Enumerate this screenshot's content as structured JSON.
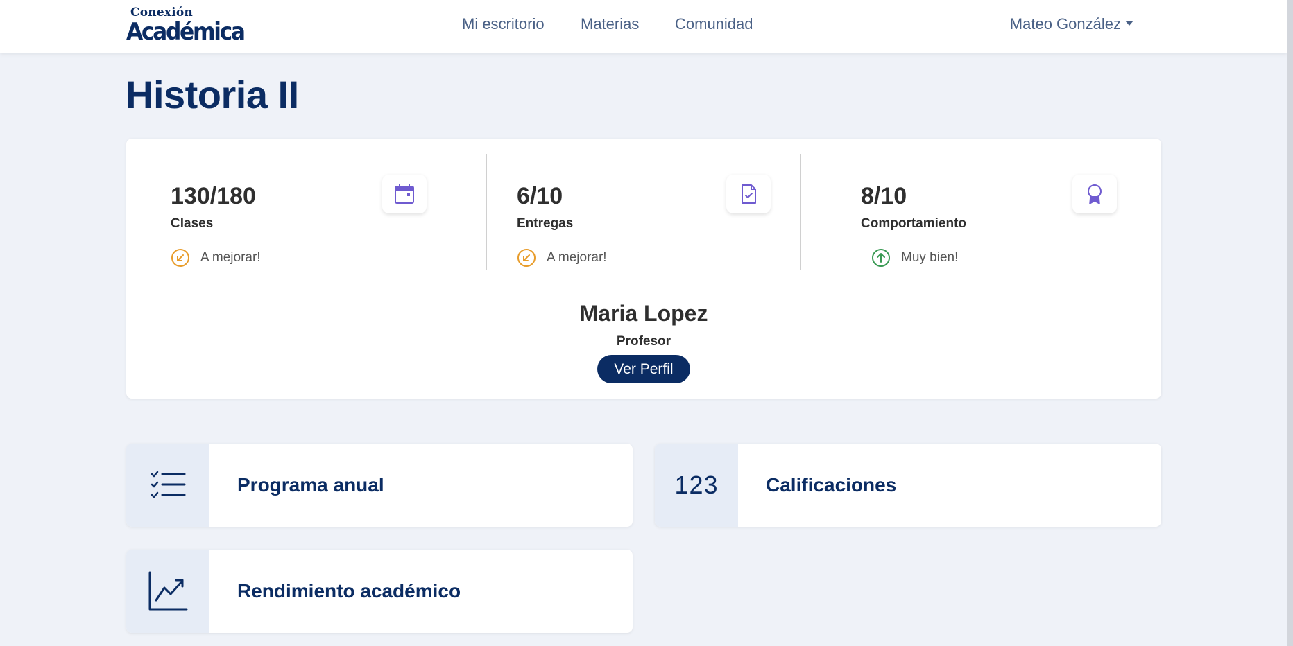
{
  "brand": {
    "top": "Conexión",
    "main": "Académica"
  },
  "nav": {
    "links": [
      "Mi escritorio",
      "Materias",
      "Comunidad"
    ],
    "user": "Mateo González"
  },
  "page": {
    "title": "Historia II"
  },
  "stats": [
    {
      "value": "130/180",
      "label": "Clases",
      "trend": "A mejorar!",
      "trend_direction": "down",
      "icon": "calendar-icon"
    },
    {
      "value": "6/10",
      "label": "Entregas",
      "trend": "A mejorar!",
      "trend_direction": "down",
      "icon": "document-check-icon"
    },
    {
      "value": "8/10",
      "label": "Comportamiento",
      "trend": "Muy bien!",
      "trend_direction": "up",
      "icon": "award-icon"
    }
  ],
  "teacher": {
    "name": "Maria Lopez",
    "role": "Profesor",
    "button": "Ver Perfil"
  },
  "tiles": [
    {
      "label": "Programa anual",
      "icon": "checklist-icon"
    },
    {
      "label": "Calificaciones",
      "icon": "numbers-icon",
      "icon_text": "123"
    },
    {
      "label": "Rendimiento académico",
      "icon": "chart-line-icon"
    }
  ],
  "colors": {
    "primary": "#0b2c63",
    "icon_accent": "#6f5bd0",
    "warning": "#e89c2a",
    "success": "#3a9a54",
    "background": "#eff2f8"
  }
}
